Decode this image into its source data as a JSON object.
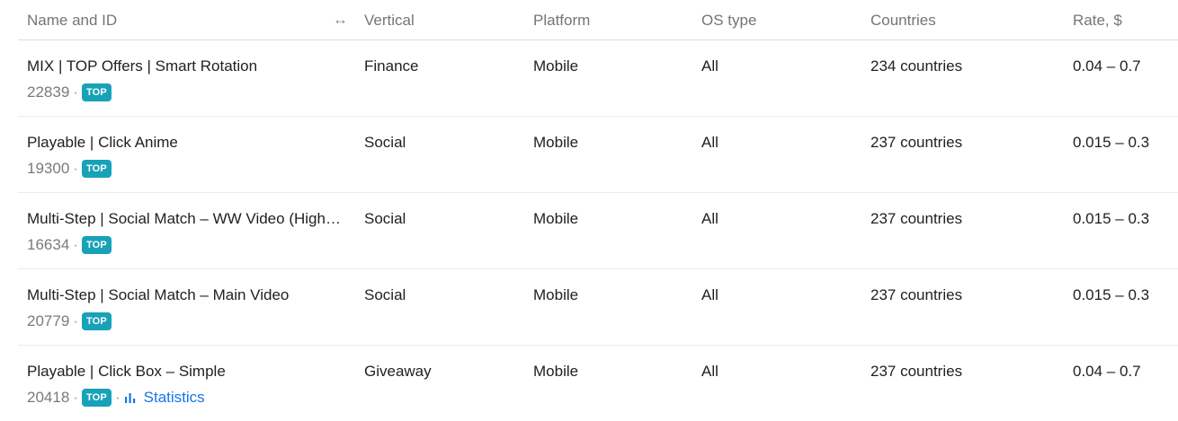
{
  "headers": {
    "name": "Name and ID",
    "resize_glyph": "↔",
    "vertical": "Vertical",
    "platform": "Platform",
    "os": "OS type",
    "countries": "Countries",
    "rate": "Rate, $"
  },
  "separator": "·",
  "rows": [
    {
      "name": "MIX | TOP Offers | Smart Rotation",
      "id": "22839",
      "badge": "TOP",
      "vertical": "Finance",
      "platform": "Mobile",
      "os": "All",
      "countries": "234 countries",
      "rate": "0.04 – 0.7"
    },
    {
      "name": "Playable | Click Anime",
      "id": "19300",
      "badge": "TOP",
      "vertical": "Social",
      "platform": "Mobile",
      "os": "All",
      "countries": "237 countries",
      "rate": "0.015 – 0.3"
    },
    {
      "name": "Multi-Step | Social Match – WW Video (High…",
      "id": "16634",
      "badge": "TOP",
      "vertical": "Social",
      "platform": "Mobile",
      "os": "All",
      "countries": "237 countries",
      "rate": "0.015 – 0.3"
    },
    {
      "name": "Multi-Step | Social Match – Main Video",
      "id": "20779",
      "badge": "TOP",
      "vertical": "Social",
      "platform": "Mobile",
      "os": "All",
      "countries": "237 countries",
      "rate": "0.015 – 0.3"
    },
    {
      "name": "Playable | Click Box – Simple",
      "id": "20418",
      "badge": "TOP",
      "vertical": "Giveaway",
      "platform": "Mobile",
      "os": "All",
      "countries": "237 countries",
      "rate": "0.04 – 0.7",
      "stats_label": "Statistics"
    }
  ],
  "icons": {
    "resize": "resize-horizontal-icon",
    "statistics": "bar-chart-icon"
  },
  "colors": {
    "badge": "#17a2b8",
    "link": "#1a73e8",
    "header_text": "#757575"
  }
}
